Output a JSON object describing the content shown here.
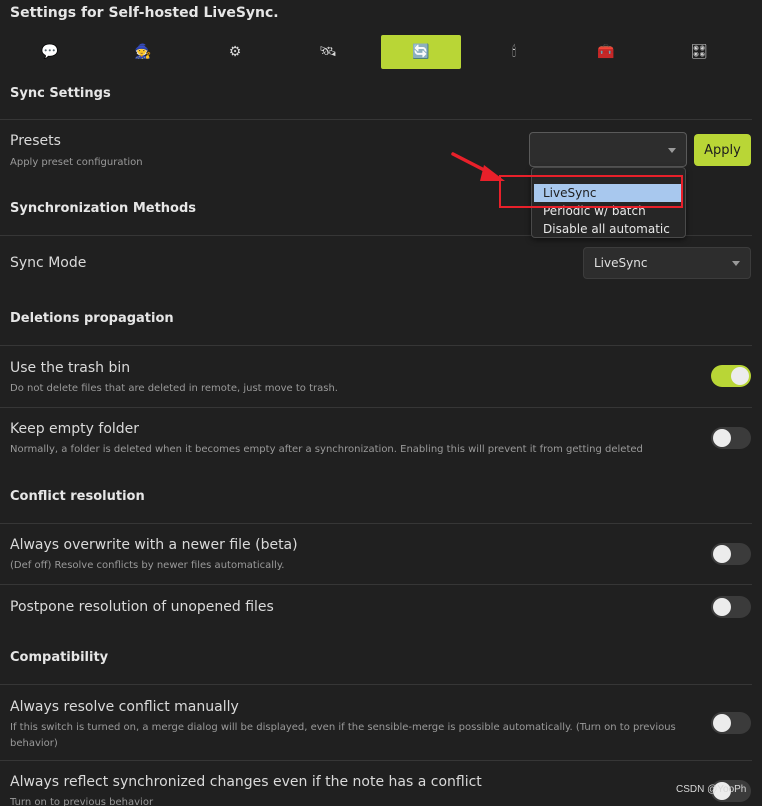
{
  "page": {
    "title": "Settings for Self-hosted LiveSync."
  },
  "tabs": [
    {
      "icon": "speech-bubble-icon",
      "glyph": "💬",
      "active": false
    },
    {
      "icon": "setup-wizard-icon",
      "glyph": "🧙",
      "active": false
    },
    {
      "icon": "gear-icon",
      "glyph": "⚙",
      "active": false
    },
    {
      "icon": "satellite-icon",
      "glyph": "🛰",
      "active": false
    },
    {
      "icon": "sync-arrows-icon",
      "glyph": "🔄",
      "active": true
    },
    {
      "icon": "candle-icon",
      "glyph": "🕯",
      "active": false
    },
    {
      "icon": "toolbox-icon",
      "glyph": "🧰",
      "active": false
    },
    {
      "icon": "control-knobs-icon",
      "glyph": "🎛",
      "active": false
    }
  ],
  "sync_settings": {
    "header": "Sync Settings",
    "presets": {
      "title": "Presets",
      "desc": "Apply preset configuration",
      "select_value": "",
      "apply_label": "Apply",
      "dropdown_options": [
        "LiveSync",
        "Periodic w/ batch",
        "Disable all automatic"
      ],
      "highlighted_option": "LiveSync"
    }
  },
  "sync_methods": {
    "header": "Synchronization Methods",
    "sync_mode": {
      "title": "Sync Mode",
      "value": "LiveSync"
    }
  },
  "deletions": {
    "header": "Deletions propagation",
    "trash": {
      "title": "Use the trash bin",
      "desc": "Do not delete files that are deleted in remote, just move to trash.",
      "on": true
    },
    "keep_empty": {
      "title": "Keep empty folder",
      "desc": "Normally, a folder is deleted when it becomes empty after a synchronization. Enabling this will prevent it from getting deleted",
      "on": false
    }
  },
  "conflict": {
    "header": "Conflict resolution",
    "overwrite": {
      "title": "Always overwrite with a newer file (beta)",
      "desc": "(Def off) Resolve conflicts by newer files automatically.",
      "on": false
    },
    "postpone": {
      "title": "Postpone resolution of unopened files",
      "on": false
    }
  },
  "compat": {
    "header": "Compatibility",
    "resolve_manual": {
      "title": "Always resolve conflict manually",
      "desc": "If this switch is turned on, a merge dialog will be displayed, even if the sensible-merge is possible automatically. (Turn on to previous behavior)",
      "on": false
    },
    "reflect": {
      "title": "Always reflect synchronized changes even if the note has a conflict",
      "desc": "Turn on to previous behavior",
      "on": false
    }
  },
  "annotation": {
    "color": "#e8202a"
  },
  "colors": {
    "accent": "#b9d636",
    "highlight": "#a8c8ee",
    "background": "#202020"
  },
  "watermark": "CSDN @YooPh"
}
